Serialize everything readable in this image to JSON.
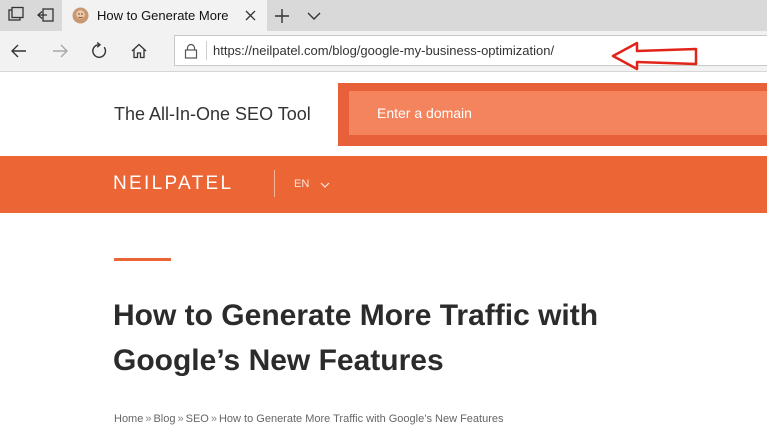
{
  "browser": {
    "tab": {
      "title": "How to Generate More"
    },
    "address_bar": {
      "url": "https://neilpatel.com/blog/google-my-business-optimization/"
    },
    "icons": {
      "tab_preview": "tab-preview-icon",
      "set_aside": "set-aside-tabs-icon",
      "favicon": "avatar-favicon-icon",
      "close": "close-icon",
      "new_tab": "plus-icon",
      "tab_menu": "chevron-down-icon",
      "back": "back-arrow-icon",
      "forward": "forward-arrow-icon",
      "refresh": "refresh-icon",
      "home": "home-icon",
      "lock": "lock-icon",
      "annotation": "red-arrow-annotation-icon"
    }
  },
  "promo": {
    "tagline": "The All-In-One SEO Tool",
    "domain_placeholder": "Enter a domain"
  },
  "site_nav": {
    "logo": "NEILPATEL",
    "language": "EN"
  },
  "article": {
    "title": "How to Generate More Traffic with Google’s New Features",
    "breadcrumb": [
      "Home",
      "Blog",
      "SEO",
      "How to Generate More Traffic with Google’s New Features"
    ]
  },
  "colors": {
    "brand_orange": "#ec6534",
    "promo_box": "#e8603a",
    "promo_input": "#f4845d",
    "annotation_red": "#e2231a"
  }
}
